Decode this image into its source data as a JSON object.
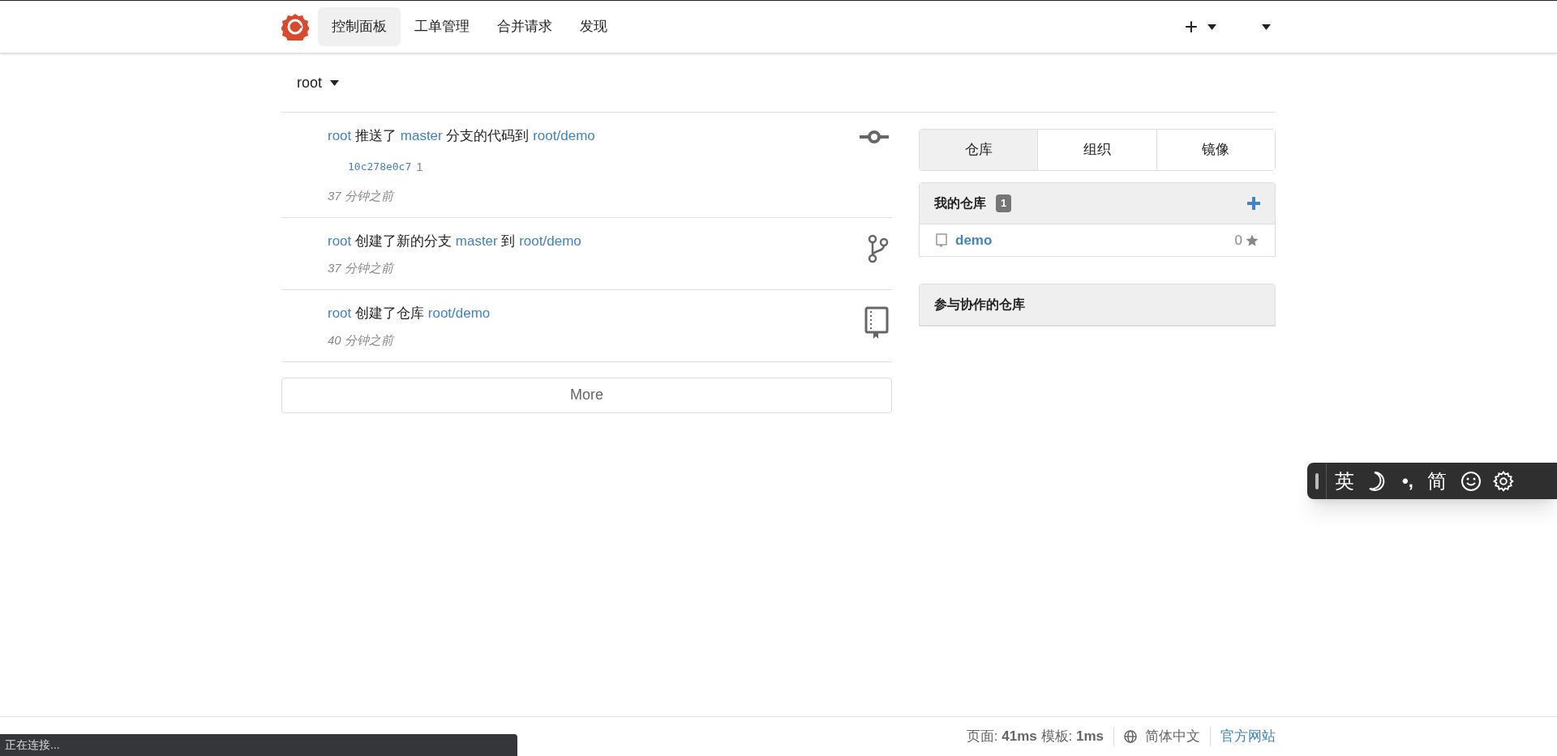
{
  "nav": {
    "items": [
      {
        "label": "控制面板",
        "selected": true
      },
      {
        "label": "工单管理",
        "selected": false
      },
      {
        "label": "合并请求",
        "selected": false
      },
      {
        "label": "发现",
        "selected": false
      }
    ],
    "plus": "+"
  },
  "context": {
    "label": "root"
  },
  "feed": [
    {
      "kind": "push",
      "segments": [
        {
          "text": "root",
          "link": true
        },
        {
          "text": "推送了",
          "link": false
        },
        {
          "text": "master",
          "link": true
        },
        {
          "text": "分支的代码到",
          "link": false
        },
        {
          "text": "root/demo",
          "link": true
        }
      ],
      "commit": {
        "sha": "10c278e0c7",
        "message": "1"
      },
      "time": "37 分钟之前"
    },
    {
      "kind": "branch",
      "segments": [
        {
          "text": "root",
          "link": true
        },
        {
          "text": "创建了新的分支",
          "link": false
        },
        {
          "text": "master",
          "link": true
        },
        {
          "text": "到",
          "link": false
        },
        {
          "text": "root/demo",
          "link": true
        }
      ],
      "time": "37 分钟之前"
    },
    {
      "kind": "repo",
      "segments": [
        {
          "text": "root",
          "link": true
        },
        {
          "text": "创建了仓库",
          "link": false
        },
        {
          "text": "root/demo",
          "link": true
        }
      ],
      "time": "40 分钟之前"
    }
  ],
  "more": "More",
  "tabs": [
    {
      "label": "仓库",
      "selected": true
    },
    {
      "label": "组织",
      "selected": false
    },
    {
      "label": "镜像",
      "selected": false
    }
  ],
  "my_repos": {
    "title": "我的仓库",
    "count": "1",
    "repos": [
      {
        "name": "demo",
        "stars": "0"
      }
    ]
  },
  "collab_repos": {
    "title": "参与协作的仓库"
  },
  "footer": {
    "timing": "页面: **41ms** 模板: **1ms**",
    "language": "简体中文",
    "website": "官方网站"
  },
  "ime": {
    "mode": "英",
    "punct": "•,",
    "script": "简"
  },
  "status": "正在连接..."
}
